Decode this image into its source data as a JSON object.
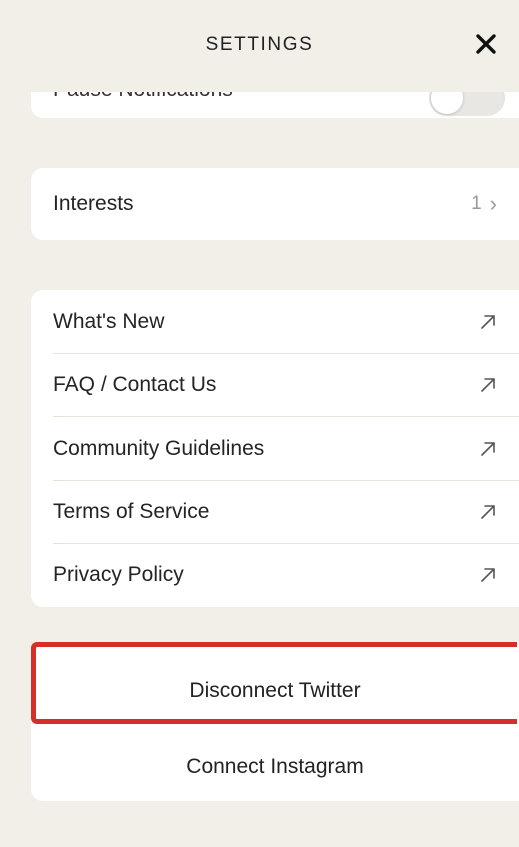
{
  "header": {
    "title": "SETTINGS",
    "close_icon": "close-icon"
  },
  "notifications": {
    "label": "Pause Notifications",
    "toggle_state": "off"
  },
  "interests": {
    "label": "Interests",
    "count": "1",
    "chevron": "›"
  },
  "links": [
    {
      "label": "What's New",
      "icon": "external-link-icon"
    },
    {
      "label": "FAQ / Contact Us",
      "icon": "external-link-icon"
    },
    {
      "label": "Community Guidelines",
      "icon": "external-link-icon"
    },
    {
      "label": "Terms of Service",
      "icon": "external-link-icon"
    },
    {
      "label": "Privacy Policy",
      "icon": "external-link-icon"
    }
  ],
  "social": {
    "disconnect_twitter": "Disconnect Twitter",
    "connect_instagram": "Connect Instagram"
  },
  "colors": {
    "background": "#f2efe8",
    "card": "#ffffff",
    "highlight": "#d62f2a"
  }
}
